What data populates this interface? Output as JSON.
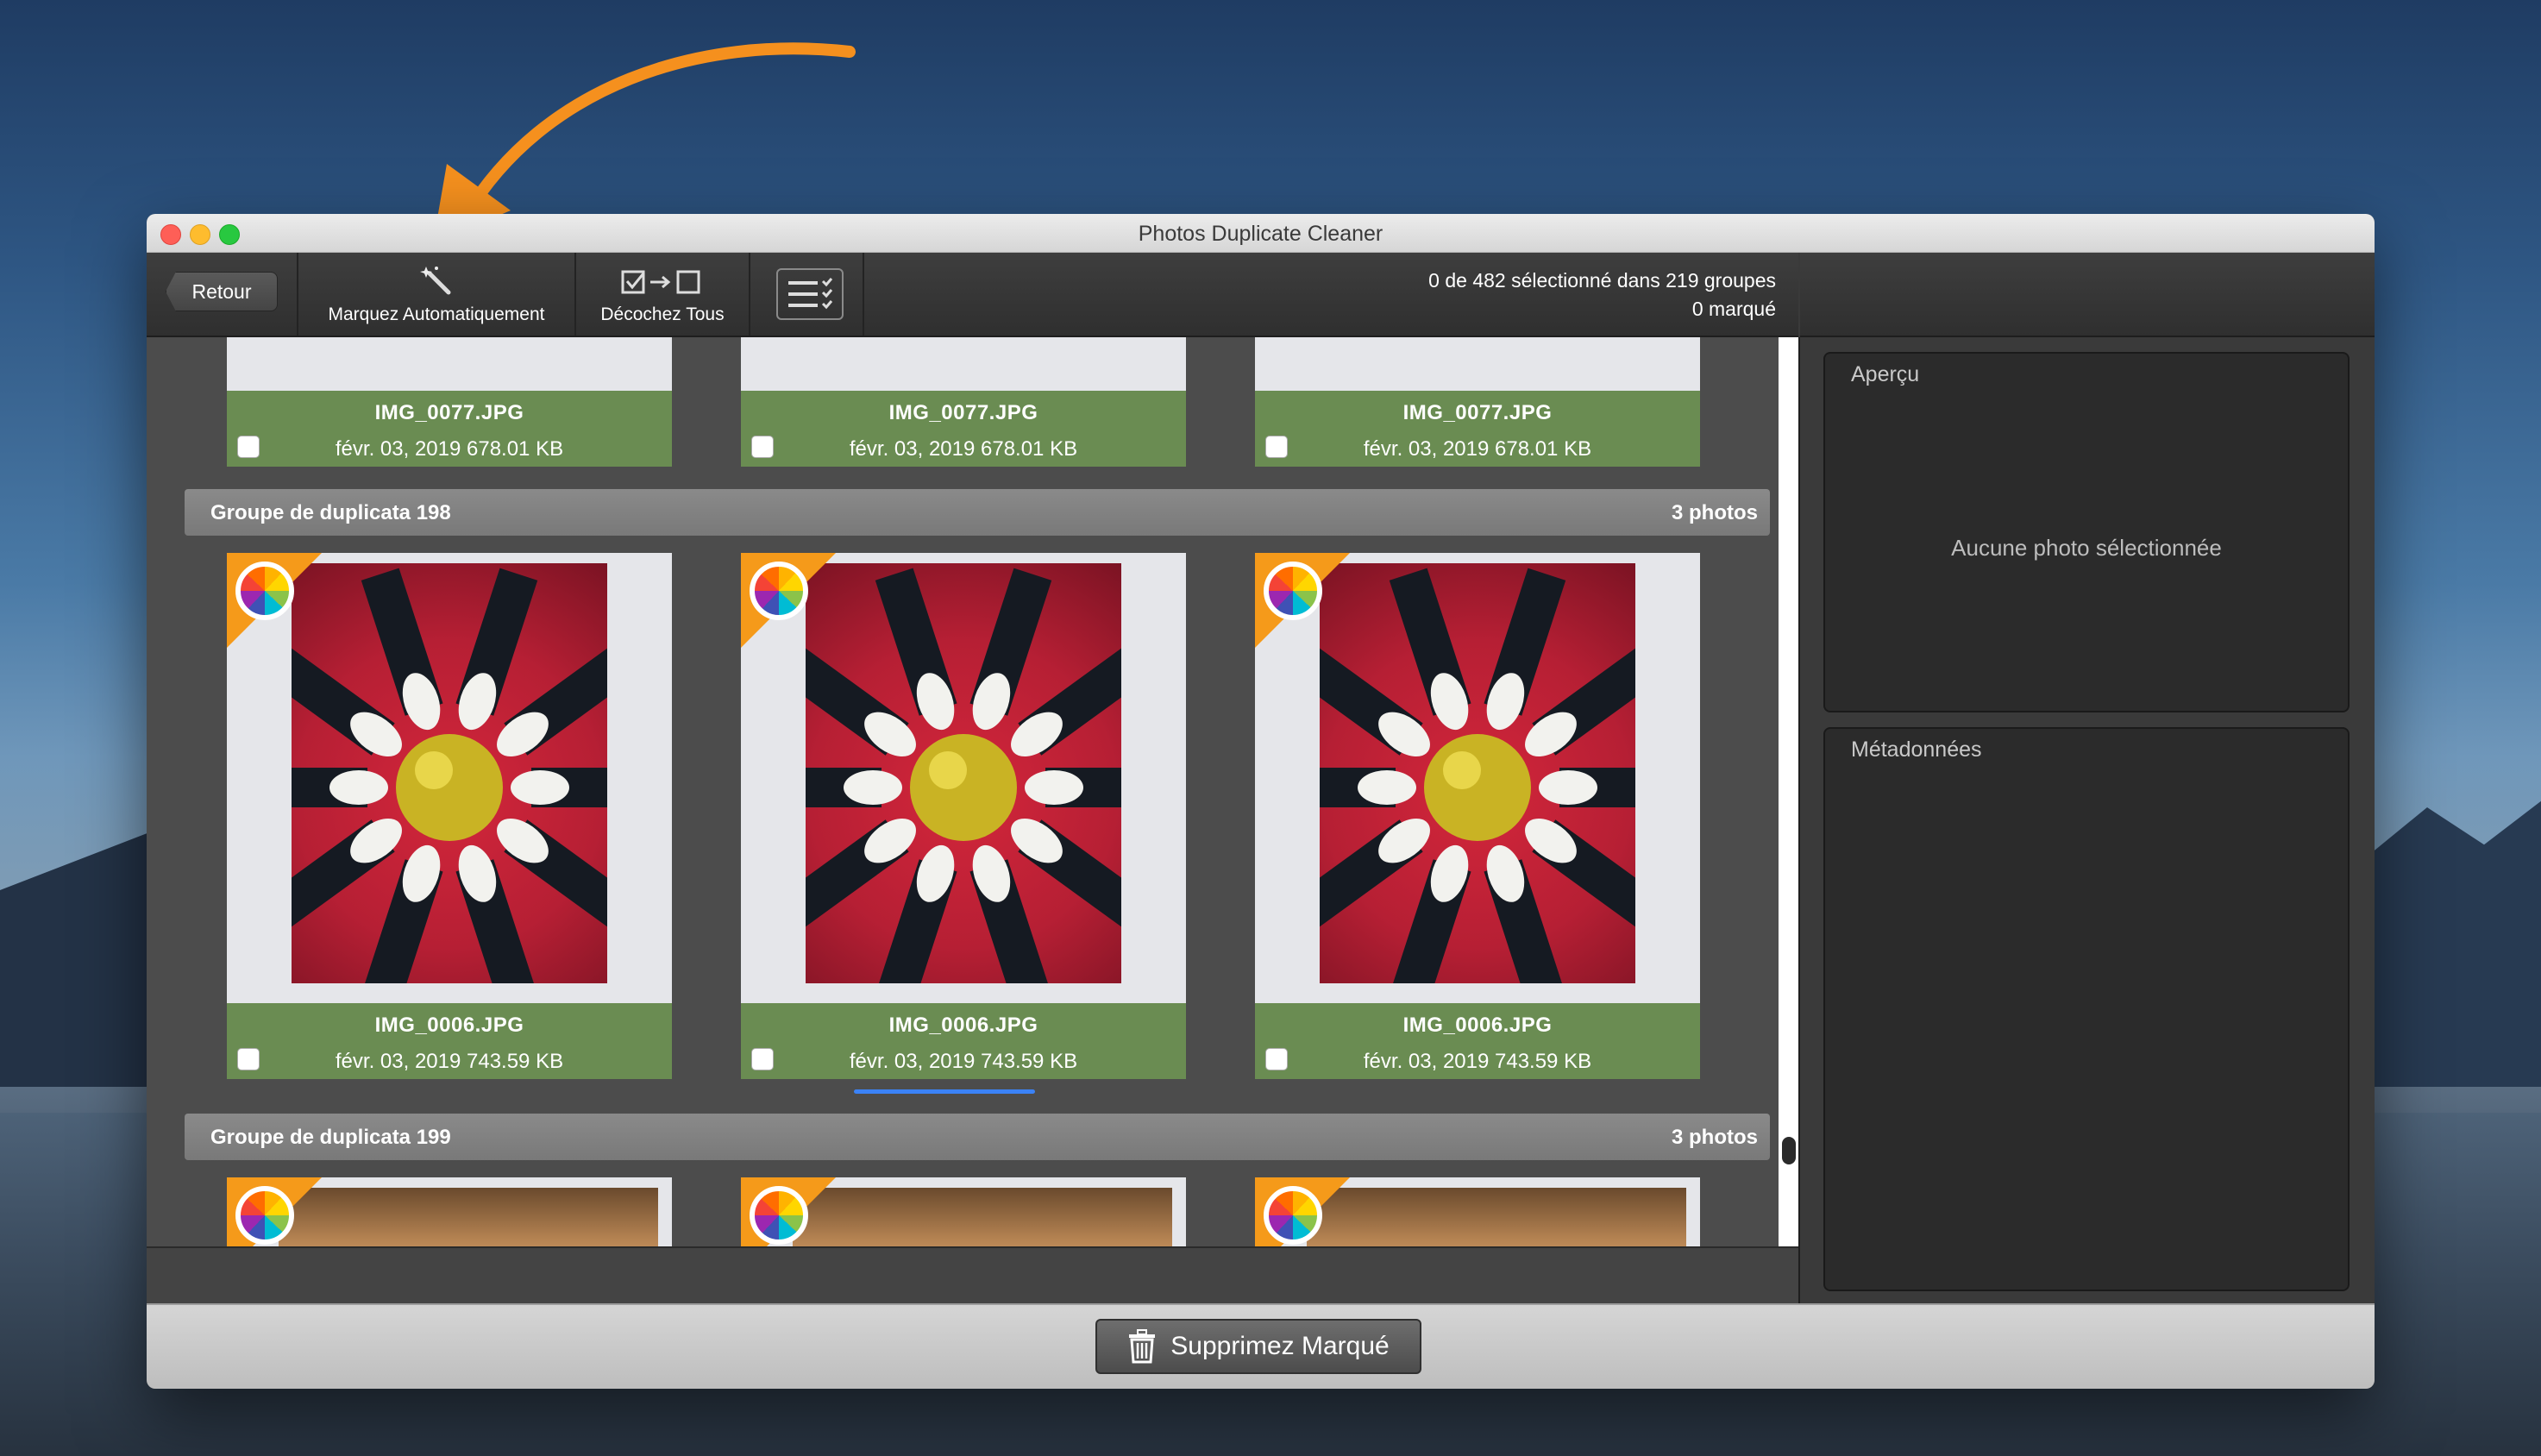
{
  "window": {
    "title": "Photos Duplicate Cleaner"
  },
  "toolbar": {
    "back_label": "Retour",
    "auto_mark_label": "Marquez Automatiquement",
    "uncheck_all_label": "Décochez Tous",
    "status_line1": "0 de 482 sélectionné dans 219 groupes",
    "status_line2": "0 marqué"
  },
  "groups": [
    {
      "cards": [
        {
          "filename": "IMG_0077.JPG",
          "meta": "févr. 03, 2019  678.01 KB"
        },
        {
          "filename": "IMG_0077.JPG",
          "meta": "févr. 03, 2019  678.01 KB"
        },
        {
          "filename": "IMG_0077.JPG",
          "meta": "févr. 03, 2019  678.01 KB"
        }
      ]
    },
    {
      "title": "Groupe de duplicata  198",
      "count": "3 photos",
      "cards": [
        {
          "filename": "IMG_0006.JPG",
          "meta": "févr. 03, 2019  743.59 KB"
        },
        {
          "filename": "IMG_0006.JPG",
          "meta": "févr. 03, 2019  743.59 KB"
        },
        {
          "filename": "IMG_0006.JPG",
          "meta": "févr. 03, 2019  743.59 KB"
        }
      ]
    },
    {
      "title": "Groupe de duplicata  199",
      "count": "3 photos"
    }
  ],
  "sidebar": {
    "preview_title": "Aperçu",
    "preview_empty": "Aucune photo sélectionnée",
    "metadata_title": "Métadonnées"
  },
  "footer": {
    "delete_label": "Supprimez Marqué"
  },
  "colors": {
    "card_info": "#6a8c52",
    "annotation_arrow": "#f5901e",
    "drag_line": "#3b82f6"
  }
}
